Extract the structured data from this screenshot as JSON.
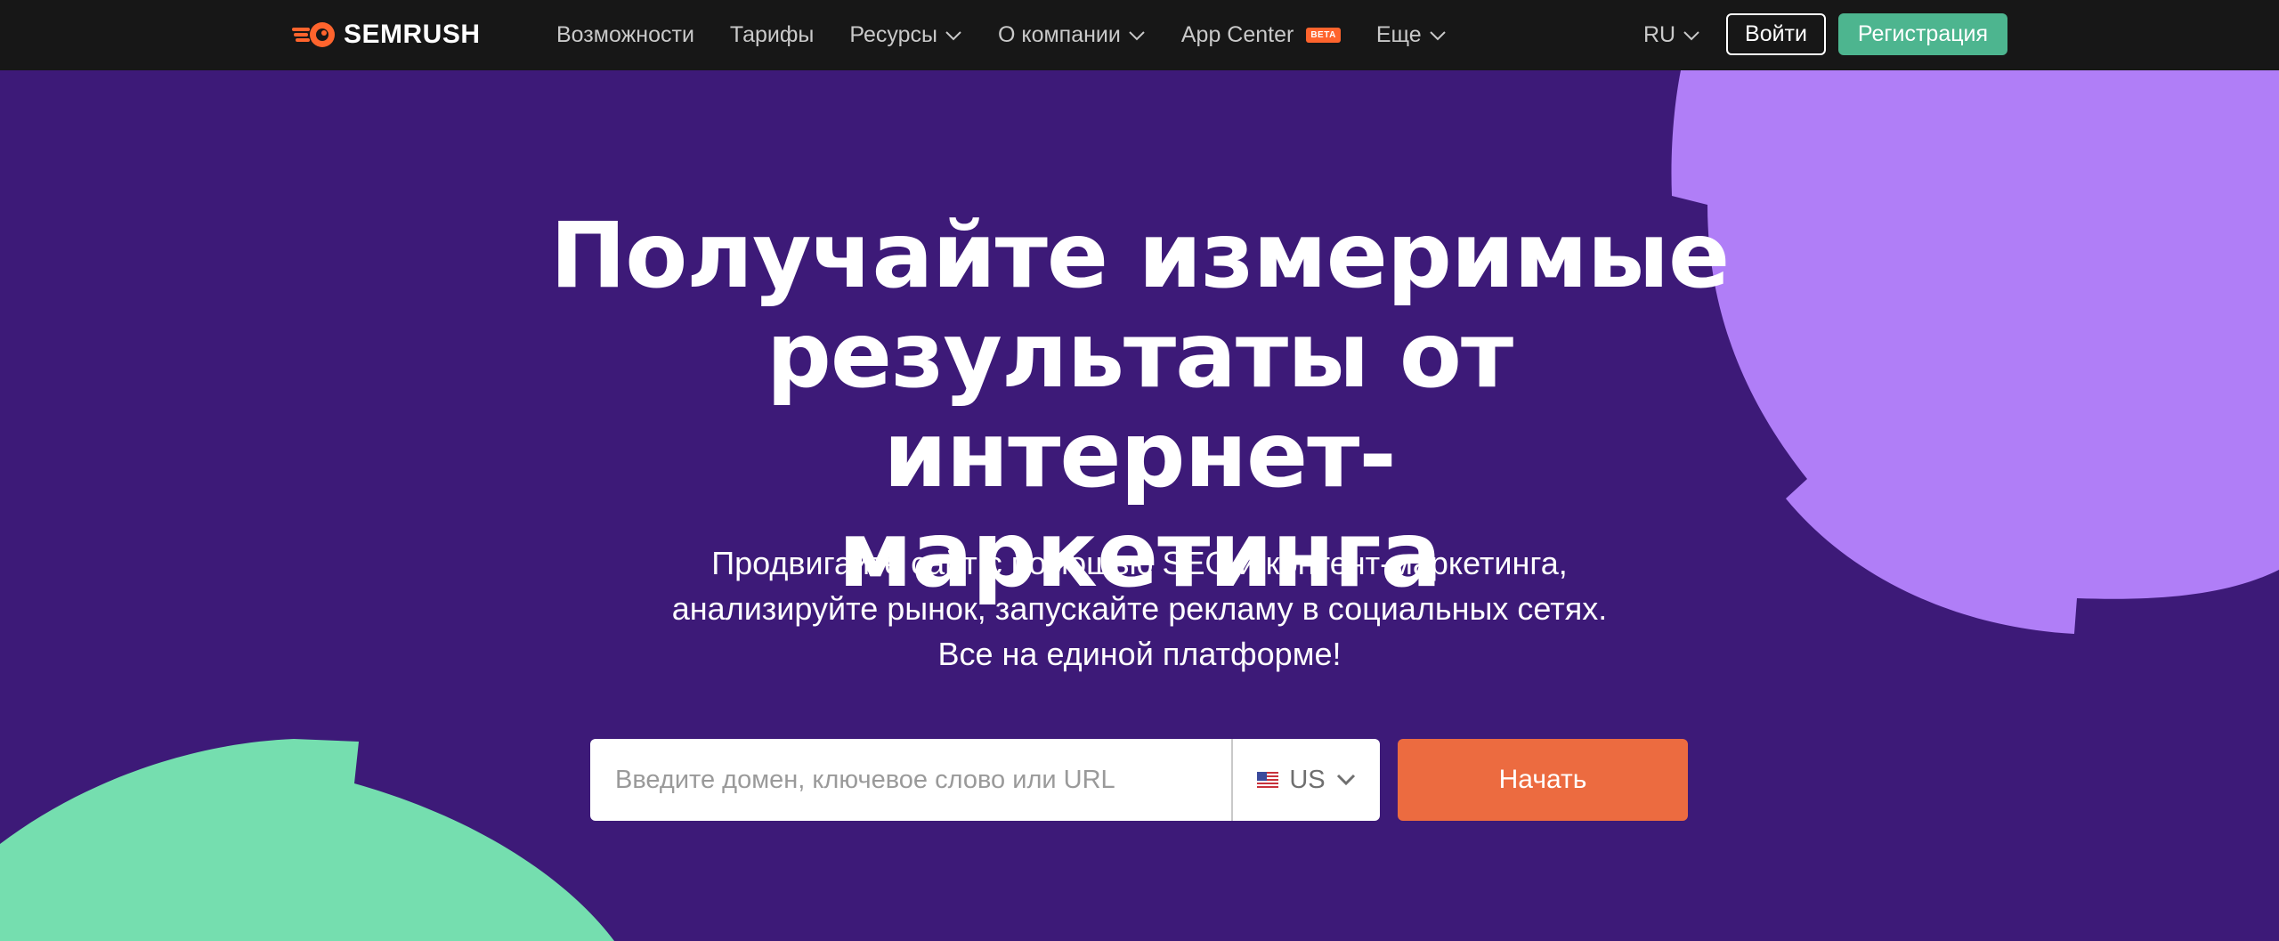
{
  "header": {
    "brand": "SEMRUSH",
    "nav": [
      {
        "label": "Возможности",
        "dropdown": false
      },
      {
        "label": "Тарифы",
        "dropdown": false
      },
      {
        "label": "Ресурсы",
        "dropdown": true
      },
      {
        "label": "О компании",
        "dropdown": true
      },
      {
        "label": "App Center",
        "dropdown": false,
        "badge": "BETA"
      },
      {
        "label": "Еще",
        "dropdown": true
      }
    ],
    "language": "RU",
    "login_label": "Войти",
    "register_label": "Регистрация"
  },
  "hero": {
    "title_lines": [
      "Получайте измеримые",
      "результаты от интернет-",
      "маркетинга"
    ],
    "subtitle_lines": [
      "Продвигайте сайт с помощью SEO и контент-маркетинга,",
      "анализируйте рынок, запускайте рекламу в социальных сетях.",
      "Все на единой платформе!"
    ]
  },
  "search": {
    "placeholder": "Введите домен, ключевое слово или URL",
    "value": "",
    "database": "US",
    "start_label": "Начать"
  },
  "colors": {
    "background": "#3d1a78",
    "topbar": "#171717",
    "accent_orange": "#ec6b40",
    "accent_green": "#4db58f",
    "shape_purple": "#b07ef7",
    "shape_green": "#75deaf"
  },
  "icons": [
    "semrush-logo-icon",
    "chevron-down-icon",
    "us-flag-icon"
  ]
}
